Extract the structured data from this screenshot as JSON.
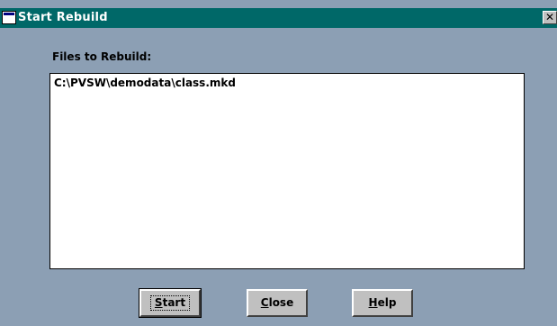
{
  "window": {
    "title": "Start Rebuild",
    "close_glyph": "✕"
  },
  "files": {
    "label": "Files to Rebuild:",
    "items": [
      "C:\\PVSW\\demodata\\class.mkd"
    ]
  },
  "buttons": {
    "start": {
      "mnemonic": "S",
      "rest": "tart"
    },
    "close": {
      "mnemonic": "C",
      "rest": "lose"
    },
    "help": {
      "mnemonic": "H",
      "rest": "elp"
    }
  },
  "colors": {
    "titlebar": "#006868",
    "dialog_bg": "#8c9fb4",
    "button_face": "#c0c0c0"
  }
}
